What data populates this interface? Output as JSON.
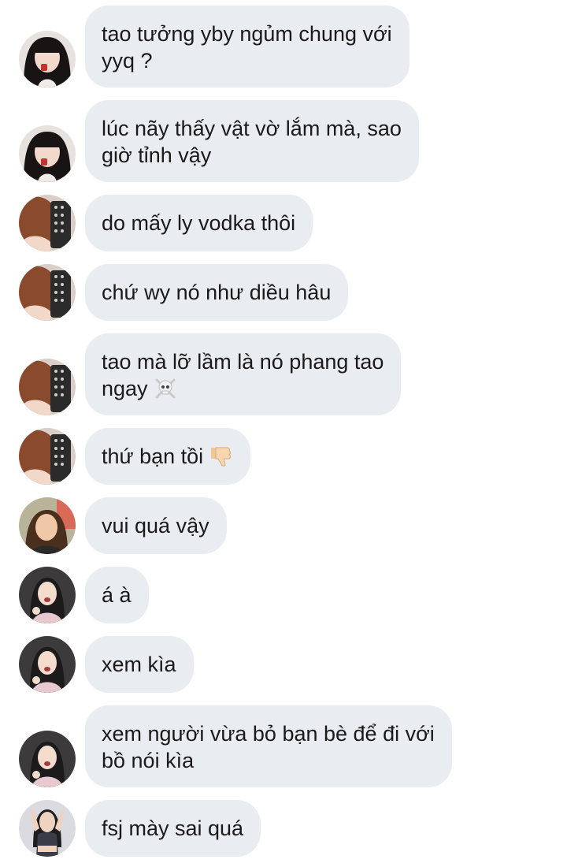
{
  "messages": [
    {
      "sender": "user-a",
      "text": "tao tưởng yby ngủm chung với\nyyq ?"
    },
    {
      "sender": "user-a",
      "text": "lúc nãy thấy vật vờ lắm mà, sao\ngiờ tỉnh vậy"
    },
    {
      "sender": "user-b",
      "text": "do mấy ly vodka thôi"
    },
    {
      "sender": "user-b",
      "text": "chứ wy nó như diều hâu"
    },
    {
      "sender": "user-b",
      "text": "tao mà lỡ lầm là nó phang tao\nngay",
      "emoji": "skull-crossbones-icon"
    },
    {
      "sender": "user-b",
      "text": "thứ bạn tồi",
      "emoji": "thumbs-down-icon"
    },
    {
      "sender": "user-c",
      "text": "vui quá vậy"
    },
    {
      "sender": "user-d",
      "text": "á à"
    },
    {
      "sender": "user-d",
      "text": "xem kìa"
    },
    {
      "sender": "user-d",
      "text": "xem người vừa bỏ bạn bè để đi với\nbồ nói kìa"
    },
    {
      "sender": "user-e",
      "text": "fsj mày sai quá"
    }
  ],
  "colors": {
    "bubble_bg": "#e9ecf0",
    "text": "#1a1a1a",
    "background": "#ffffff"
  }
}
